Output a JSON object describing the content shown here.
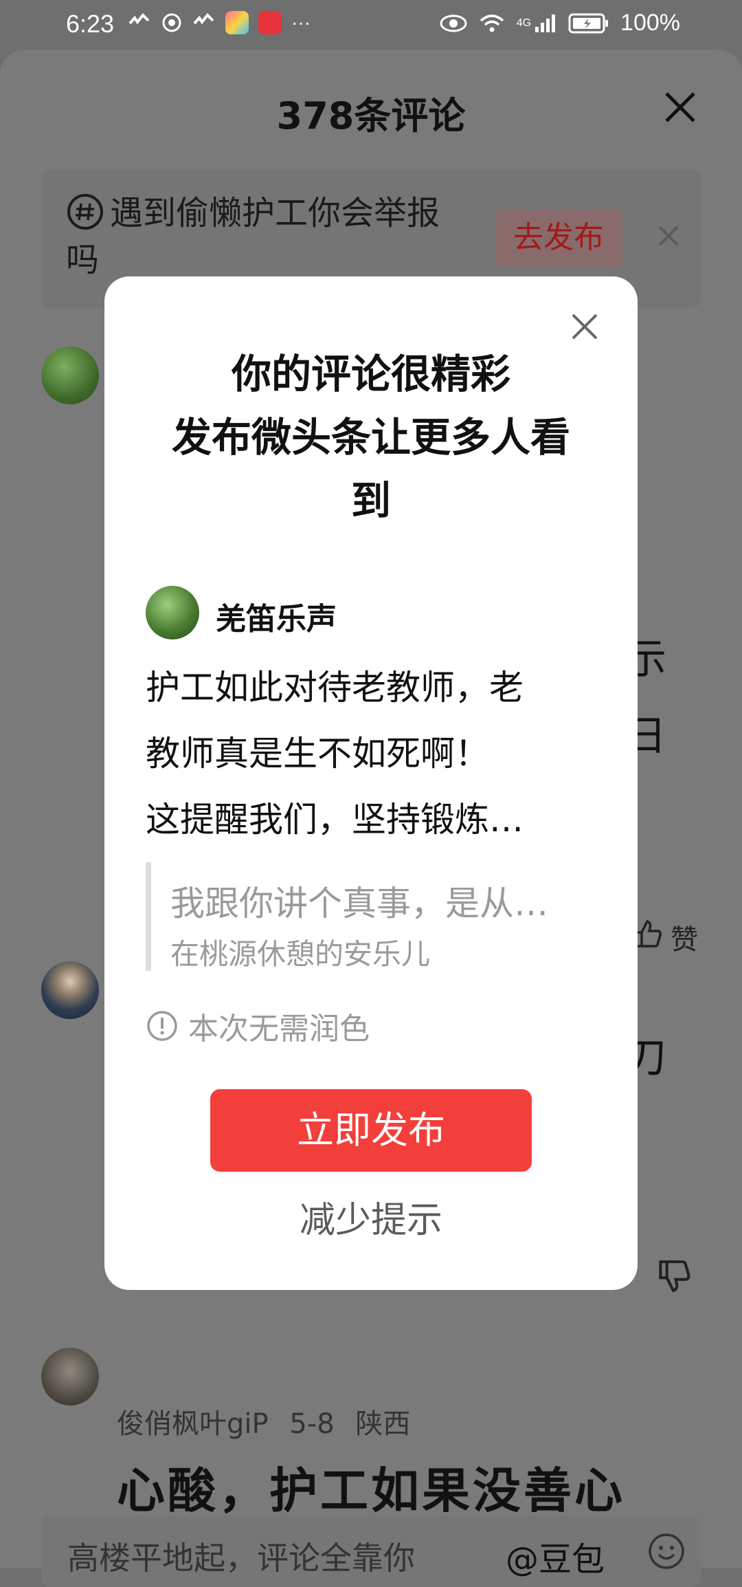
{
  "status_bar": {
    "time": "6:23",
    "more": "···",
    "network": "4G",
    "battery": "100%"
  },
  "sheet": {
    "title": "378条评论"
  },
  "topic": {
    "text": "遇到偷懒护工你会举报吗",
    "button": "去发布"
  },
  "background": {
    "like_label": "赞",
    "frag_1": "示",
    "frag_2": "日",
    "frag_3": "刀",
    "comment": {
      "user": "俊俏枫叶giP",
      "date": "5-8",
      "region": "陕西",
      "text": "心酸，护工如果没善心"
    }
  },
  "reply_bar": {
    "placeholder": "高楼平地起，评论全靠你",
    "mention": "@豆包"
  },
  "modal": {
    "title_line1": "你的评论很精彩",
    "title_line2": "发布微头条让更多人看",
    "title_line3": "到",
    "author": "羌笛乐声",
    "content_line1": "护工如此对待老教师，老",
    "content_line2": "教师真是生不如死啊！",
    "content_line3": "这提醒我们，坚持锻炼…",
    "quote_line1": "我跟你讲个真事，是从…",
    "quote_line2": "在桃源休憩的安乐儿",
    "notice": "本次无需润色",
    "primary_button": "立即发布",
    "secondary_button": "减少提示"
  },
  "colors": {
    "primary_red": "#f33f3b",
    "overlay": "#7a7a7a"
  }
}
